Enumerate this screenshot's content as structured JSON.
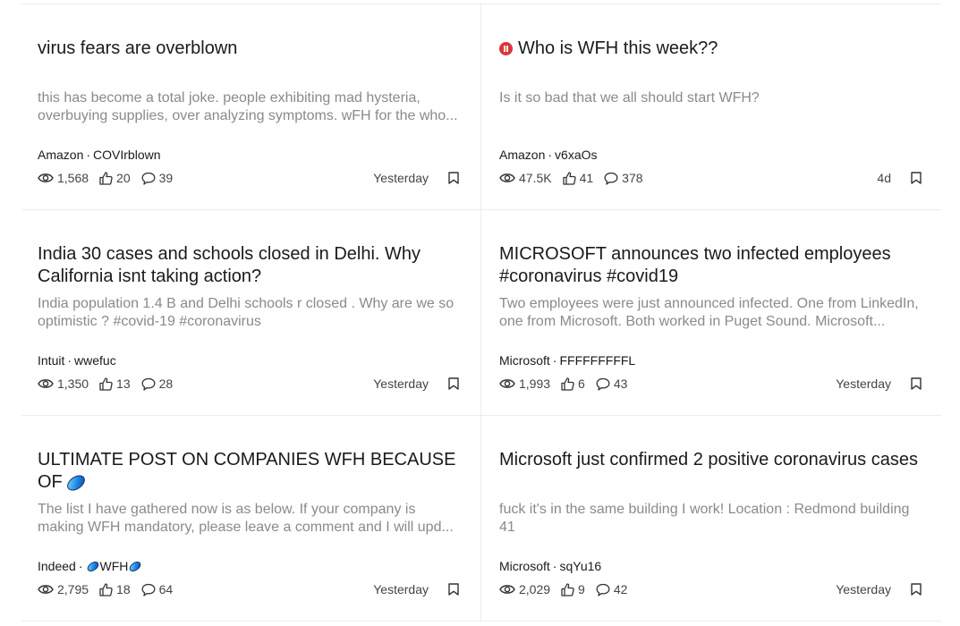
{
  "posts": [
    {
      "title": "virus fears are overblown",
      "preview": "this has become a total joke. people exhibiting mad hysteria, overbuying supplies, over analyzing symptoms. wFH for the who...",
      "company": "Amazon",
      "author": "COVIrblown",
      "views": "1,568",
      "likes": "20",
      "comments": "39",
      "time": "Yesterday"
    },
    {
      "title": "Who is WFH this week??",
      "hot": true,
      "preview": "Is it so bad that we all should start WFH?",
      "company": "Amazon",
      "author": "v6xaOs",
      "views": "47.5K",
      "likes": "41",
      "comments": "378",
      "time": "4d"
    },
    {
      "title": "India 30 cases and schools closed in Delhi. Why California isnt taking action?",
      "preview": "India population 1.4 B and Delhi schools r closed . Why are we so optimistic ? #covid-19 #coronavirus",
      "company": "Intuit",
      "author": "wwefuc",
      "views": "1,350",
      "likes": "13",
      "comments": "28",
      "time": "Yesterday"
    },
    {
      "title": "MICROSOFT announces two infected employees #coronavirus #covid19",
      "preview": "Two employees were just announced infected. One from LinkedIn, one from Microsoft. Both worked in Puget Sound. Microsoft...",
      "company": "Microsoft",
      "author": "FFFFFFFFFL",
      "views": "1,993",
      "likes": "6",
      "comments": "43",
      "time": "Yesterday"
    },
    {
      "title": "ULTIMATE POST ON COMPANIES WFH BECAUSE OF",
      "title_gem": true,
      "preview": "The list I have gathered now is as below. If your company is making WFH mandatory, please leave a comment and I will upd...",
      "company": "Indeed",
      "author": "WFH",
      "author_gems": true,
      "views": "2,795",
      "likes": "18",
      "comments": "64",
      "time": "Yesterday"
    },
    {
      "title": "Microsoft just confirmed 2 positive coronavirus cases",
      "preview": "fuck it's in the same building I work! Location : Redmond building 41",
      "company": "Microsoft",
      "author": "sqYu16",
      "views": "2,029",
      "likes": "9",
      "comments": "42",
      "time": "Yesterday"
    }
  ],
  "meta_separator": "·",
  "icons": {
    "views": "eye-icon",
    "likes": "thumbs-up-icon",
    "comments": "comment-icon",
    "bookmark": "bookmark-icon",
    "hot": "hot-badge-icon",
    "gem": "gem-icon"
  },
  "colors": {
    "hot_badge": "#d93737",
    "preview_text": "#8a8a8a",
    "divider": "#ececec"
  }
}
